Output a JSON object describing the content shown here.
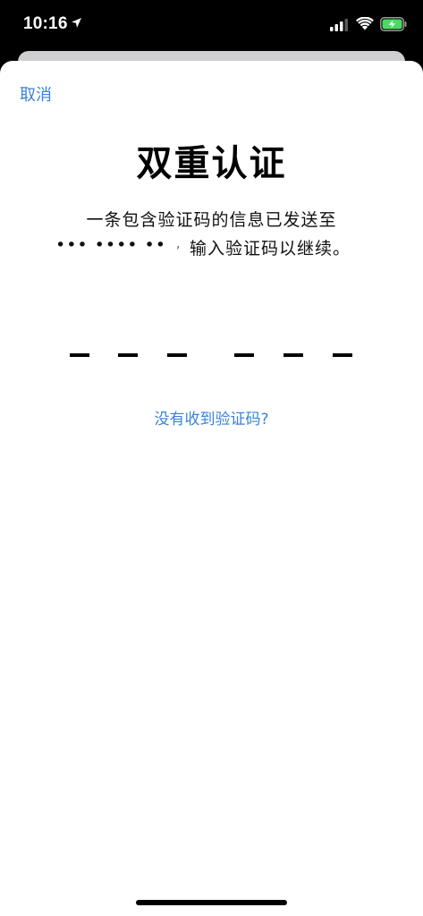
{
  "status_bar": {
    "time": "10:16",
    "icons": [
      "location-arrow-icon",
      "cellular-signal-icon",
      "wifi-icon",
      "battery-charging-icon"
    ],
    "battery_color": "#4cd964"
  },
  "sheet": {
    "cancel_label": "取消",
    "title": "双重认证",
    "message_line1": "一条包含验证码的信息已发送至",
    "masked_phone": "••• •••• ••",
    "phone_tail": ",",
    "message_suffix": "输入验证码以继续。",
    "code_slots": [
      "",
      "",
      "",
      "",
      "",
      ""
    ],
    "resend_label": "没有收到验证码?",
    "accent_color": "#3a82d8"
  }
}
